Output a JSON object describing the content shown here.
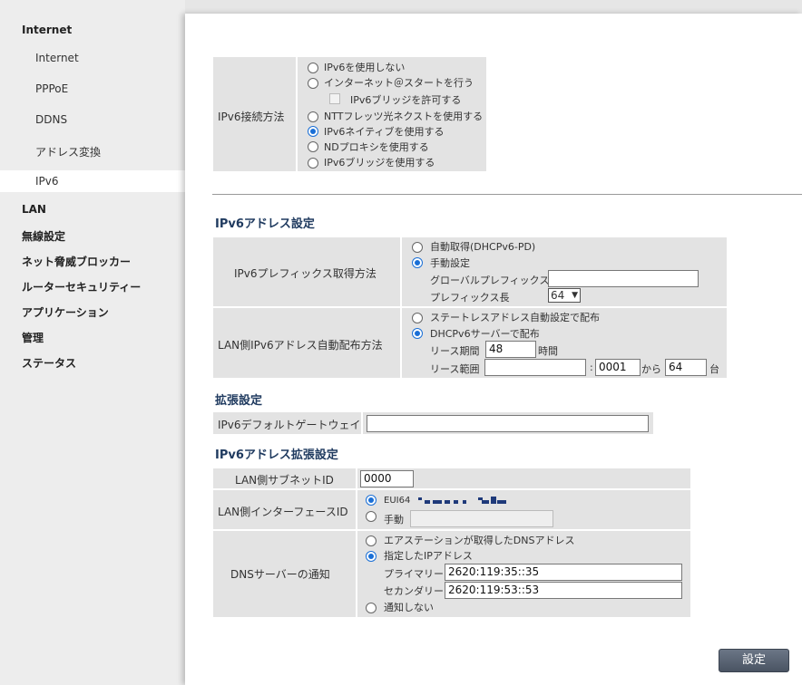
{
  "sidebar": {
    "top_items": [
      "Internet",
      "LAN",
      "無線設定",
      "ネット脅威ブロッカー",
      "ルーターセキュリティー",
      "アプリケーション",
      "管理",
      "ステータス"
    ],
    "sub_items": [
      "Internet",
      "PPPoE",
      "DDNS",
      "アドレス変換",
      "IPv6"
    ],
    "active": "IPv6"
  },
  "connection": {
    "label": "IPv6接続方法",
    "options": [
      "IPv6を使用しない",
      "インターネット＠スタートを行う",
      "IPv6ブリッジを許可する",
      "NTTフレッツ光ネクストを使用する",
      "IPv6ネイティブを使用する",
      "NDプロキシを使用する",
      "IPv6ブリッジを使用する"
    ],
    "selected": "IPv6ネイティブを使用する"
  },
  "address_settings": {
    "title": "IPv6アドレス設定",
    "prefix_label": "IPv6プレフィックス取得方法",
    "prefix_options": [
      "自動取得(DHCPv6-PD)",
      "手動設定"
    ],
    "prefix_selected": "手動設定",
    "global_prefix_label": "グローバルプレフィックス",
    "global_prefix_value": "",
    "prefix_length_label": "プレフィックス長",
    "prefix_length_value": "64",
    "lan_label": "LAN側IPv6アドレス自動配布方法",
    "lan_options": [
      "ステートレスアドレス自動設定で配布",
      "DHCPv6サーバーで配布"
    ],
    "lan_selected": "DHCPv6サーバーで配布",
    "lease_period_label": "リース期間",
    "lease_period_value": "48",
    "lease_period_unit": "時間",
    "lease_range_label": "リース範囲",
    "lease_range_prefix": "",
    "lease_range_colon": ":",
    "lease_range_start": "0001",
    "lease_range_from": "から",
    "lease_range_count": "64",
    "lease_range_unit": "台"
  },
  "extended": {
    "title": "拡張設定",
    "gateway_label": "IPv6デフォルトゲートウェイ",
    "gateway_value": ""
  },
  "address_extended": {
    "title": "IPv6アドレス拡張設定",
    "subnet_label": "LAN側サブネットID",
    "subnet_value": "0000",
    "iface_label": "LAN側インターフェースID",
    "iface_options": [
      "EUI64",
      "手動"
    ],
    "iface_selected": "EUI64",
    "iface_manual_value": "",
    "dns_label": "DNSサーバーの通知",
    "dns_options": [
      "エアステーションが取得したDNSアドレス",
      "指定したIPアドレス",
      "通知しない"
    ],
    "dns_selected": "指定したIPアドレス",
    "primary_label": "プライマリー",
    "primary_value": "2620:119:35::35",
    "secondary_label": "セカンダリー",
    "secondary_value": "2620:119:53::53"
  },
  "submit_label": "設定",
  "colors": {
    "accent": "#1a6fd6",
    "header_text": "#1f3a5f",
    "table_bg": "#e3e3e3",
    "button": "#56606f"
  }
}
